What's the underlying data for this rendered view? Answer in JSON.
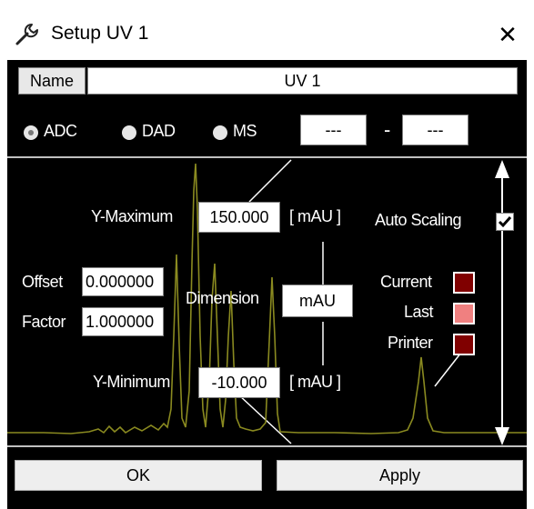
{
  "window": {
    "title": "Setup UV 1",
    "close_label": "✕"
  },
  "name": {
    "label": "Name",
    "value": "UV 1"
  },
  "source": {
    "options": [
      "ADC",
      "DAD",
      "MS"
    ],
    "selected": "ADC",
    "range_from": "---",
    "range_dash": "-",
    "range_to": "---"
  },
  "ymax": {
    "label": "Y-Maximum",
    "value": "150.000",
    "unit": "[ mAU ]"
  },
  "ymin": {
    "label": "Y-Minimum",
    "value": "-10.000",
    "unit": "[ mAU ]"
  },
  "offset": {
    "label": "Offset",
    "value": "0.000000"
  },
  "factor": {
    "label": "Factor",
    "value": "1.000000"
  },
  "dimension": {
    "label": "Dimension",
    "value": "mAU"
  },
  "auto_scaling": {
    "label": "Auto Scaling",
    "checked": true
  },
  "colors": [
    {
      "label": "Current",
      "color": "#800000"
    },
    {
      "label": "Last",
      "color": "#f08080"
    },
    {
      "label": "Printer",
      "color": "#800000"
    }
  ],
  "buttons": {
    "ok": "OK",
    "apply": "Apply"
  },
  "icons": {
    "title": "wrench-icon",
    "scale": "double-arrow-icon"
  }
}
